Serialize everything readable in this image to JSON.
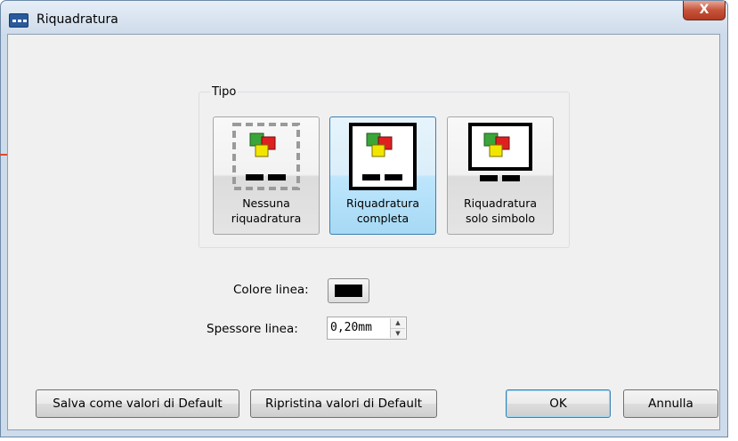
{
  "window": {
    "title": "Riquadratura",
    "close_label": "X"
  },
  "tipo": {
    "label": "Tipo",
    "options": [
      {
        "label": "Nessuna riquadratura",
        "line1": "Nessuna",
        "line2": "riquadratura",
        "selected": false,
        "icon": "no-frame-icon"
      },
      {
        "label": "Riquadratura completa",
        "line1": "Riquadratura",
        "line2": "completa",
        "selected": true,
        "icon": "full-frame-icon"
      },
      {
        "label": "Riquadratura solo simbolo",
        "line1": "Riquadratura",
        "line2": "solo simbolo",
        "selected": false,
        "icon": "symbol-frame-icon"
      }
    ]
  },
  "colore_linea": {
    "label": "Colore linea:",
    "color": "#000000"
  },
  "spessore_linea": {
    "label": "Spessore linea:",
    "value": "0,20mm"
  },
  "buttons": {
    "save_defaults": "Salva come valori di Default",
    "restore_defaults": "Ripristina valori di Default",
    "ok": "OK",
    "cancel": "Annulla"
  },
  "colors": {
    "selected_bg": "#bee6fd",
    "selected_border": "#3c7fb1",
    "symbol_green": "#3aa63a",
    "symbol_red": "#e02020",
    "symbol_yellow": "#f2e600"
  }
}
